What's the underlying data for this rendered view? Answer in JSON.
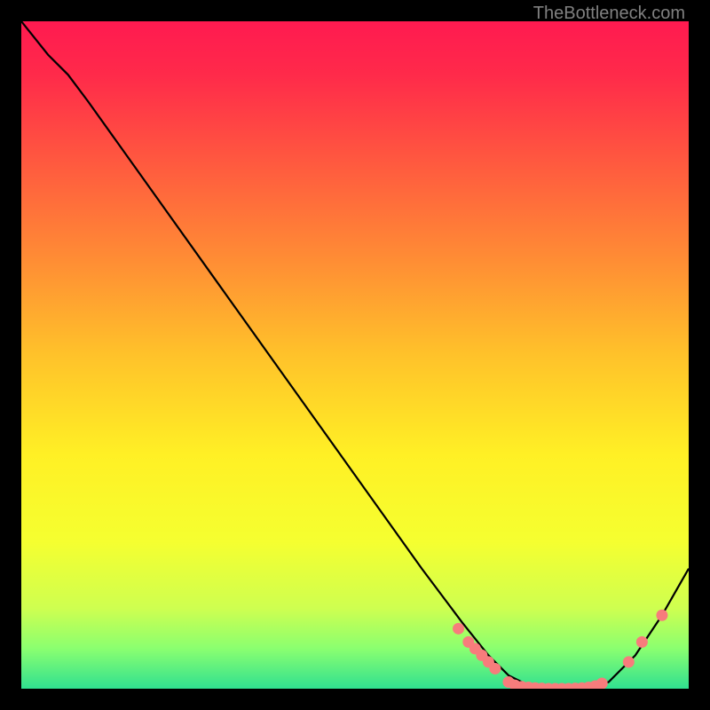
{
  "watermark": "TheBottleneck.com",
  "chart_data": {
    "type": "line",
    "title": "",
    "xlabel": "",
    "ylabel": "",
    "xlim": [
      0,
      100
    ],
    "ylim": [
      0,
      100
    ],
    "gradient_stops": [
      {
        "offset": 0.0,
        "color": "#ff1a50"
      },
      {
        "offset": 0.08,
        "color": "#ff2a4a"
      },
      {
        "offset": 0.2,
        "color": "#ff5540"
      },
      {
        "offset": 0.35,
        "color": "#ff8a35"
      },
      {
        "offset": 0.5,
        "color": "#ffc22a"
      },
      {
        "offset": 0.65,
        "color": "#fff025"
      },
      {
        "offset": 0.78,
        "color": "#f5ff30"
      },
      {
        "offset": 0.88,
        "color": "#ceff50"
      },
      {
        "offset": 0.94,
        "color": "#8aff70"
      },
      {
        "offset": 1.0,
        "color": "#30e090"
      }
    ],
    "curve_points": [
      {
        "x": 0.0,
        "y": 100.0
      },
      {
        "x": 4.0,
        "y": 95.0
      },
      {
        "x": 7.0,
        "y": 92.0
      },
      {
        "x": 10.0,
        "y": 88.0
      },
      {
        "x": 20.0,
        "y": 74.0
      },
      {
        "x": 30.0,
        "y": 60.0
      },
      {
        "x": 40.0,
        "y": 46.0
      },
      {
        "x": 50.0,
        "y": 32.0
      },
      {
        "x": 60.0,
        "y": 18.0
      },
      {
        "x": 66.0,
        "y": 10.0
      },
      {
        "x": 70.0,
        "y": 5.0
      },
      {
        "x": 73.0,
        "y": 2.0
      },
      {
        "x": 76.0,
        "y": 0.5
      },
      {
        "x": 80.0,
        "y": 0.0
      },
      {
        "x": 85.0,
        "y": 0.0
      },
      {
        "x": 88.0,
        "y": 1.0
      },
      {
        "x": 92.0,
        "y": 5.0
      },
      {
        "x": 96.0,
        "y": 11.0
      },
      {
        "x": 100.0,
        "y": 18.0
      }
    ],
    "markers": [
      {
        "x": 65.5,
        "y": 9.0
      },
      {
        "x": 67.0,
        "y": 7.0
      },
      {
        "x": 68.0,
        "y": 6.0
      },
      {
        "x": 69.0,
        "y": 5.0
      },
      {
        "x": 70.0,
        "y": 4.0
      },
      {
        "x": 71.0,
        "y": 3.0
      },
      {
        "x": 73.0,
        "y": 1.0
      },
      {
        "x": 74.0,
        "y": 0.5
      },
      {
        "x": 75.0,
        "y": 0.3
      },
      {
        "x": 76.0,
        "y": 0.2
      },
      {
        "x": 77.0,
        "y": 0.1
      },
      {
        "x": 78.0,
        "y": 0.05
      },
      {
        "x": 79.0,
        "y": 0.0
      },
      {
        "x": 80.0,
        "y": 0.0
      },
      {
        "x": 81.0,
        "y": 0.0
      },
      {
        "x": 82.0,
        "y": 0.0
      },
      {
        "x": 83.0,
        "y": 0.05
      },
      {
        "x": 84.0,
        "y": 0.1
      },
      {
        "x": 85.0,
        "y": 0.2
      },
      {
        "x": 86.0,
        "y": 0.4
      },
      {
        "x": 87.0,
        "y": 0.8
      },
      {
        "x": 91.0,
        "y": 4.0
      },
      {
        "x": 93.0,
        "y": 7.0
      },
      {
        "x": 96.0,
        "y": 11.0
      }
    ],
    "marker_color": "#f77c7c",
    "curve_color": "#000000"
  }
}
